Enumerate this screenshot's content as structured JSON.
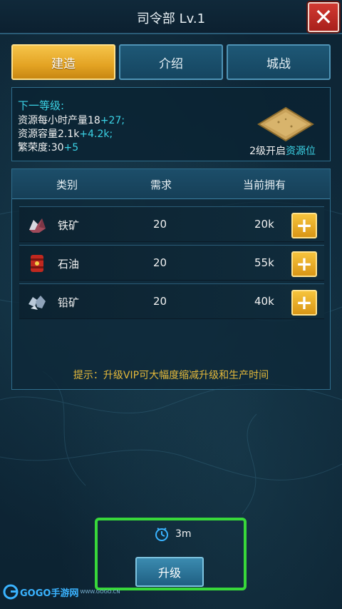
{
  "titlebar": {
    "title": "司令部 Lv.1"
  },
  "tabs": [
    {
      "label": "建造",
      "active": true
    },
    {
      "label": "介绍",
      "active": false
    },
    {
      "label": "城战",
      "active": false
    }
  ],
  "info": {
    "heading": "下一等级:",
    "lines": [
      {
        "label": "资源每小时产量18",
        "plus": "+27;"
      },
      {
        "label": "资源容量2.1k",
        "plus": "+4.2k;"
      },
      {
        "label": "繁荣度:30",
        "plus": "+5"
      }
    ],
    "unlock_prefix": "2级开启",
    "unlock_highlight": "资源位"
  },
  "resources": {
    "headers": [
      "类别",
      "需求",
      "当前拥有"
    ],
    "rows": [
      {
        "name": "铁矿",
        "need": "20",
        "have": "20k",
        "icon": "iron-ore-icon"
      },
      {
        "name": "石油",
        "need": "20",
        "have": "55k",
        "icon": "oil-barrel-icon"
      },
      {
        "name": "铅矿",
        "need": "20",
        "have": "40k",
        "icon": "lead-ore-icon"
      }
    ],
    "tip": "提示：升级VIP可大幅度缩减升级和生产时间"
  },
  "upgrade": {
    "time": "3m",
    "button": "升级"
  },
  "watermark": {
    "text": "GOGO手游网",
    "sub": "WWW.GOGO.CN"
  },
  "colors": {
    "accent_cyan": "#3bd3e6",
    "tab_active": "#e3a323",
    "tip_gold": "#e4b93b",
    "highlight_green": "#38d83a",
    "close_red": "#c42b25"
  }
}
